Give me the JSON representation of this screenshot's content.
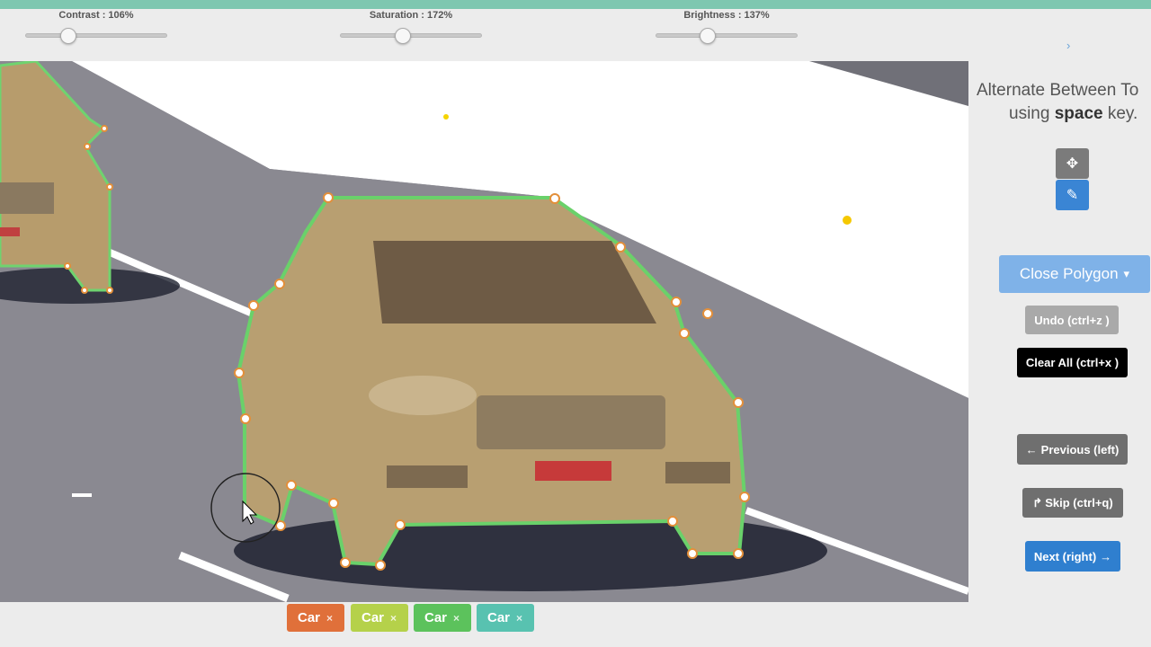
{
  "sliders": [
    {
      "label": "Contrast : 106%",
      "value": 0.3
    },
    {
      "label": "Saturation : 172%",
      "value": 0.44
    },
    {
      "label": "Brightness : 137%",
      "value": 0.36
    }
  ],
  "nav_chevron": "›",
  "side": {
    "hint_line1": "Alternate Between To",
    "hint_using": "using",
    "hint_key": "space",
    "hint_tail": "key.",
    "move_tool_icon": "move-icon",
    "pen_tool_icon": "pencil-icon",
    "close_polygon": "Close Polygon",
    "close_caret": "▾",
    "undo": "Undo (ctrl+z )",
    "clear": "Clear All (ctrl+x )",
    "prev": "Previous (left)",
    "skip": "Skip (ctrl+q)",
    "next": "Next (right)",
    "prev_icon": "←",
    "skip_icon": "↱",
    "next_icon": "→"
  },
  "tags": [
    {
      "label": "Car",
      "x": "×",
      "color": "#e0703a"
    },
    {
      "label": "Car",
      "x": "×",
      "color": "#b5d14a"
    },
    {
      "label": "Car",
      "x": "×",
      "color": "#5cc25c"
    },
    {
      "label": "Car",
      "x": "×",
      "color": "#58c2b0"
    }
  ],
  "colors": {
    "accent": "#7ec7b0",
    "polygon": "#6ad16a",
    "vertex": "#ffffff"
  }
}
